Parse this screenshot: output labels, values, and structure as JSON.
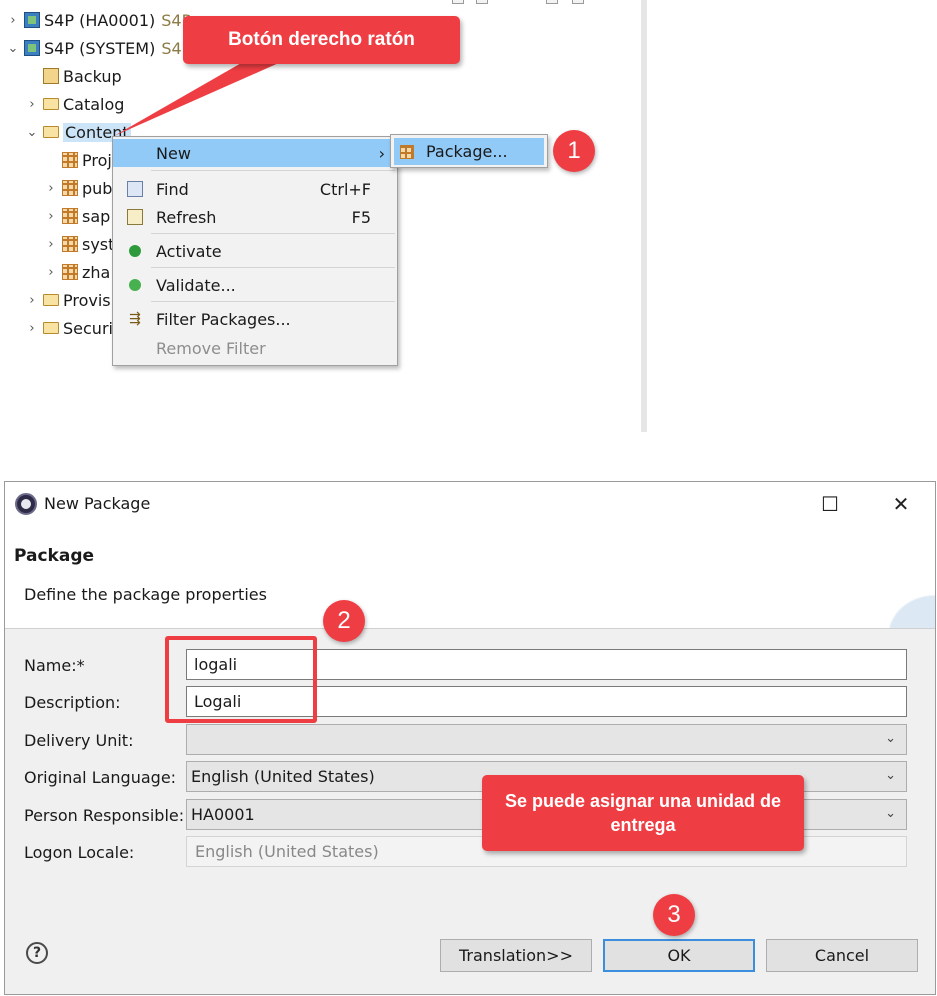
{
  "tree": {
    "items": [
      {
        "label": "S4P (HA0001)",
        "sub": "S4P"
      },
      {
        "label": "S4P (SYSTEM)",
        "sub": "S4P"
      },
      {
        "label": "Backup"
      },
      {
        "label": "Catalog"
      },
      {
        "label": "Content"
      },
      {
        "label": "Proj"
      },
      {
        "label": "pub"
      },
      {
        "label": "sap"
      },
      {
        "label": "syst"
      },
      {
        "label": "zha"
      },
      {
        "label": "Provis"
      },
      {
        "label": "Securi"
      }
    ]
  },
  "context_menu": {
    "new": "New",
    "find": "Find",
    "find_shortcut": "Ctrl+F",
    "refresh": "Refresh",
    "refresh_shortcut": "F5",
    "activate": "Activate",
    "validate": "Validate...",
    "filter_packages": "Filter Packages...",
    "remove_filter": "Remove Filter"
  },
  "submenu": {
    "package": "Package..."
  },
  "callouts": {
    "right_click": "Botón derecho ratón",
    "delivery_unit_note": "Se puede asignar una unidad de entrega",
    "step1": "1",
    "step2": "2",
    "step3": "3"
  },
  "dialog": {
    "title": "New Package",
    "maximize": "☐",
    "close": "✕",
    "heading": "Package",
    "description": "Define the package properties",
    "fields": {
      "name_label": "Name:*",
      "name_value": "logali",
      "description_label": "Description:",
      "description_value": "Logali",
      "delivery_unit_label": "Delivery Unit:",
      "delivery_unit_value": "",
      "original_language_label": "Original Language:",
      "original_language_value": "English (United States)",
      "person_responsible_label": "Person Responsible:",
      "person_responsible_value": "HA0001",
      "logon_locale_label": "Logon Locale:",
      "logon_locale_value": "English (United States)"
    },
    "help": "?",
    "buttons": {
      "translation": "Translation>>",
      "ok": "OK",
      "cancel": "Cancel"
    }
  },
  "colors": {
    "accent_red": "#ef3e43",
    "menu_highlight": "#91c9f7",
    "selection": "#cce4f7"
  }
}
